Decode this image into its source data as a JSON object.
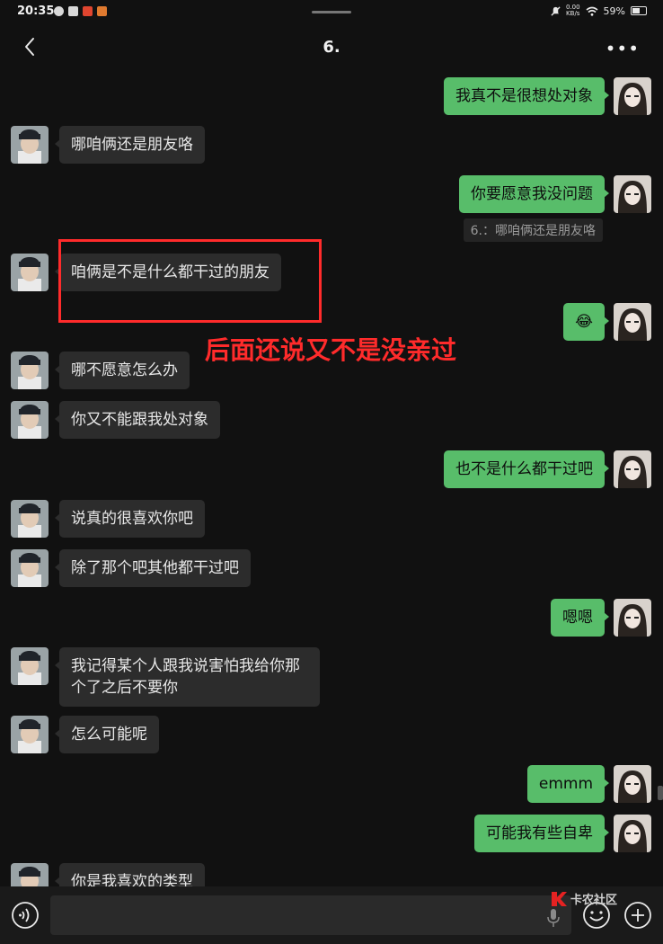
{
  "status": {
    "time": "20:35",
    "net_speed_value": "0.00",
    "net_speed_unit": "KB/s",
    "battery": "59%"
  },
  "header": {
    "title": "6."
  },
  "messages": [
    {
      "side": "right",
      "text": "我真不是很想处对象"
    },
    {
      "side": "left",
      "text": "哪咱俩还是朋友咯"
    },
    {
      "side": "right",
      "text": "你要愿意我没问题",
      "quote": "6.：哪咱俩还是朋友咯"
    },
    {
      "side": "left",
      "text": "咱俩是不是什么都干过的朋友"
    },
    {
      "side": "right",
      "text": "😂"
    },
    {
      "side": "left",
      "text": "哪不愿意怎么办"
    },
    {
      "side": "left",
      "text": "你又不能跟我处对象"
    },
    {
      "side": "right",
      "text": "也不是什么都干过吧"
    },
    {
      "side": "left",
      "text": "说真的很喜欢你吧"
    },
    {
      "side": "left",
      "text": "除了那个吧其他都干过吧"
    },
    {
      "side": "right",
      "text": "嗯嗯"
    },
    {
      "side": "left",
      "text": "我记得某个人跟我说害怕我给你那个了之后不要你"
    },
    {
      "side": "left",
      "text": "怎么可能呢"
    },
    {
      "side": "right",
      "text": "emmm"
    },
    {
      "side": "right",
      "text": "可能我有些自卑"
    },
    {
      "side": "left",
      "text": "你是我喜欢的类型"
    }
  ],
  "annotation": {
    "text": "后面还说又不是没亲过",
    "color": "#ff2b2b"
  },
  "watermark": {
    "text": "卡农社区"
  },
  "colors": {
    "bubble_right": "#58bd6a",
    "bubble_left": "#2c2c2c",
    "background": "#111111"
  },
  "icons": {
    "back": "chevron-left-icon",
    "more": "more-dots-icon",
    "voice": "voice-icon",
    "emoji": "emoji-icon",
    "plus": "plus-icon"
  }
}
